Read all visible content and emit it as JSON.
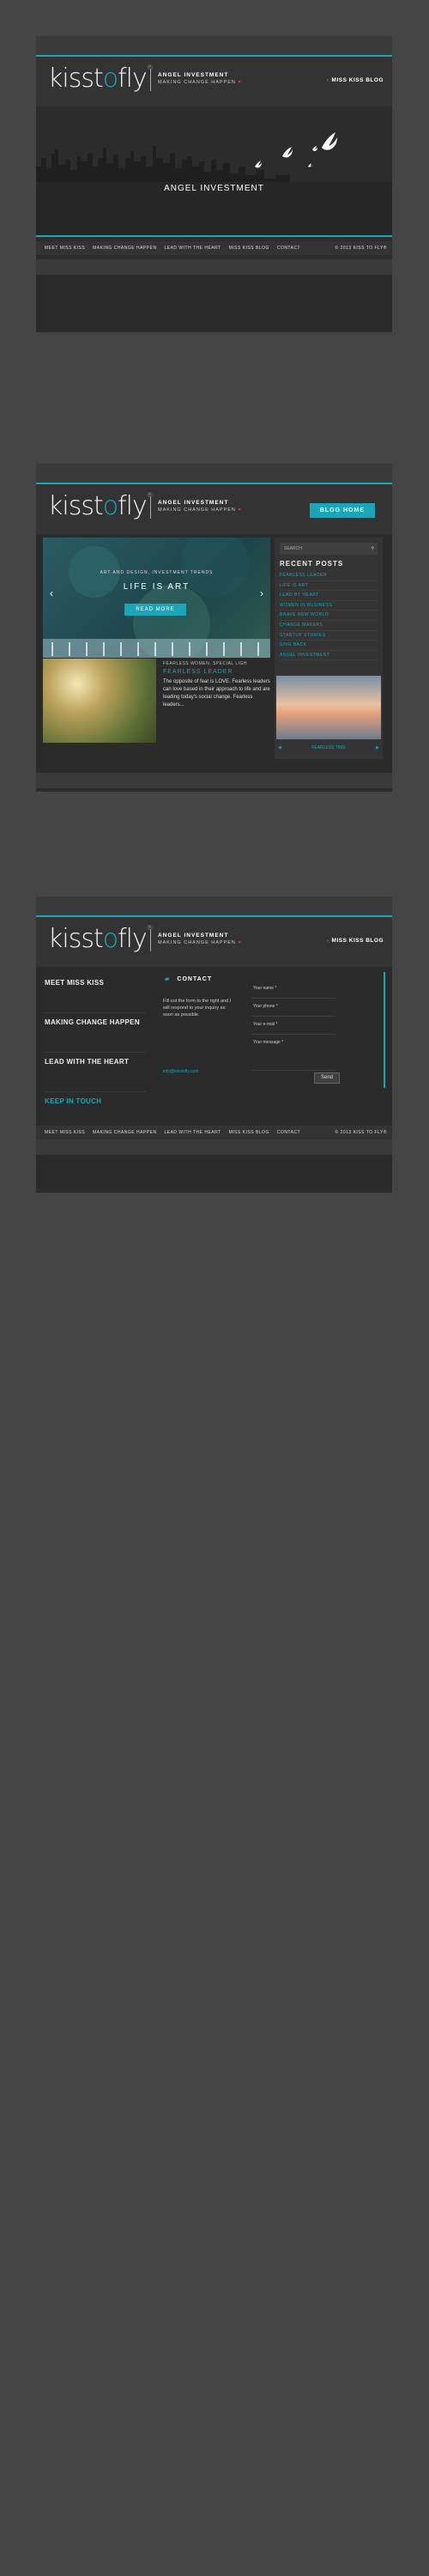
{
  "brand": {
    "logo_prefix": "kisst",
    "logo_o": "o",
    "logo_suffix": "fly",
    "reg": "®",
    "tagline_main": "ANGEL INVESTMENT",
    "tagline_sub": "MAKING CHANGE HAPPEN",
    "heart": "♥",
    "teal": "#1aa6b7"
  },
  "nav": {
    "blog_link": "MISS KISS BLOG",
    "blog_home": "BLOG HOME"
  },
  "hero": {
    "title": "ANGEL INVESTMENT"
  },
  "footer": {
    "links": [
      "MEET MISS KISS",
      "MAKING CHANGE HAPPEN",
      "LEAD WITH THE HEART",
      "MISS KISS BLOG",
      "CONTACT"
    ],
    "copyright": "© 2013 KISS TO FLY®"
  },
  "blog": {
    "slider_kicker": "ART AND DESIGN, INVESTMENT TRENDS",
    "slider_title": "LIFE IS ART",
    "read_more": "READ MORE",
    "search_placeholder": "SEARCH",
    "recent_heading": "RECENT POSTS",
    "recent": [
      "FEARLESS LEADER",
      "LIFE IS ART",
      "LEAD BY HEART",
      "WOMEN IN BUSINESS",
      "BRAVE NEW WORLD",
      "CHANGE MAKERS",
      "STARTUP STORIES",
      "GIVE BACK",
      "ANGEL INVESTMENT"
    ],
    "post_meta": "FEARLESS WOMEN, SPECIAL LIGH",
    "post_title": "FEARLESS LEADER",
    "post_body": "The opposite of fear is LOVE. Fearless leaders can love based in their approach to life and are leading today's social change. Fearless leaders...",
    "pager_label": "FEARLESS TIME"
  },
  "contact": {
    "menu": [
      "MEET MISS KISS",
      "MAKING CHANGE HAPPEN",
      "LEAD WITH THE HEART",
      "KEEP IN TOUCH"
    ],
    "heading": "CONTACT",
    "intro": "Fill out the form to the right and I will respond to your inquiry as soon as possible.",
    "email": "info@kisstofly.com",
    "fields": [
      "Your name *",
      "Your phone *",
      "Your e-mail *",
      "Your message *"
    ],
    "send": "Send"
  }
}
